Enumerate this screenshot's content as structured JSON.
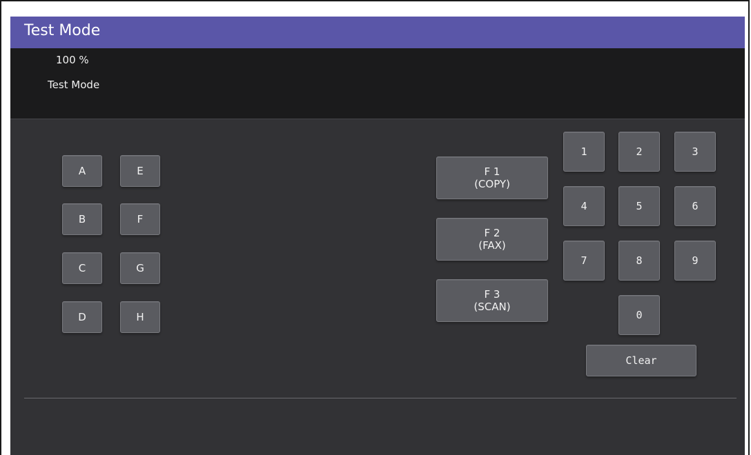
{
  "window": {
    "title": "Test Mode"
  },
  "status": {
    "zoom": "100 %",
    "mode": "Test Mode"
  },
  "letters": [
    "A",
    "E",
    "B",
    "F",
    "C",
    "G",
    "D",
    "H"
  ],
  "functions": [
    {
      "line1": "F 1",
      "line2": "(COPY)"
    },
    {
      "line1": "F 2",
      "line2": "(FAX)"
    },
    {
      "line1": "F 3",
      "line2": "(SCAN)"
    }
  ],
  "keypad": [
    "1",
    "2",
    "3",
    "4",
    "5",
    "6",
    "7",
    "8",
    "9",
    "0"
  ],
  "clear_label": "Clear"
}
